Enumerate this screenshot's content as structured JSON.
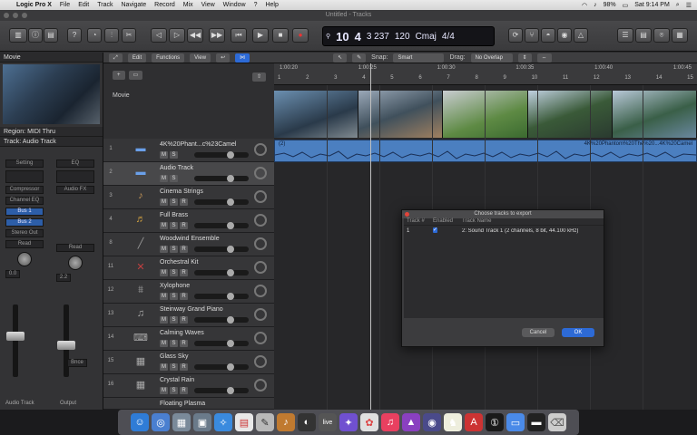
{
  "menubar": {
    "app_name": "Logic Pro X",
    "items": [
      "File",
      "Edit",
      "Track",
      "Navigate",
      "Record",
      "Mix",
      "View",
      "Window",
      "?",
      "Help"
    ],
    "battery": "98%",
    "clock": "Sat 9:14 PM"
  },
  "window": {
    "title": "Untitled - Tracks"
  },
  "lcd": {
    "bar": "10",
    "beat": "4",
    "tempo_sub": "3 237",
    "tempo": "120",
    "key": "Cmaj",
    "signature": "4/4"
  },
  "left_panel": {
    "movie_header": "Movie",
    "region_header": "Region: MIDI Thru",
    "track_header": "Track: Audio Track",
    "channel1": {
      "eq": "Setting",
      "insert1": "Compressor",
      "insert2": "Channel EQ",
      "bus1": "Bus 1",
      "bus2": "Bus 2",
      "output": "Stereo Out",
      "mode": "Read",
      "value": "0.0",
      "name": "Audio Track"
    },
    "channel2": {
      "eq": "EQ",
      "fx": "Audio FX",
      "mode": "Read",
      "value": "2.2",
      "bounce": "Bnce",
      "name": "Output"
    }
  },
  "tracks_toolbar": {
    "edit": "Edit",
    "functions": "Functions",
    "view": "View",
    "snap_label": "Snap:",
    "snap_value": "Smart",
    "drag_label": "Drag:",
    "drag_value": "No Overlap"
  },
  "movie_track_label": "Movie",
  "tracks": [
    {
      "num": "1",
      "name": "4K%20Phant...c%23Camel",
      "icon": "audio-waveform-icon"
    },
    {
      "num": "2",
      "name": "Audio Track",
      "icon": "audio-waveform-icon"
    },
    {
      "num": "3",
      "name": "Cinema Strings",
      "icon": "violin-icon"
    },
    {
      "num": "4",
      "name": "Full Brass",
      "icon": "trumpet-icon"
    },
    {
      "num": "8",
      "name": "Woodwind Ensemble",
      "icon": "flute-icon"
    },
    {
      "num": "11",
      "name": "Orchestral Kit",
      "icon": "drum-icon"
    },
    {
      "num": "12",
      "name": "Xylophone",
      "icon": "xylophone-icon"
    },
    {
      "num": "13",
      "name": "Steinway Grand Piano",
      "icon": "piano-icon"
    },
    {
      "num": "14",
      "name": "Calming Waves",
      "icon": "keyboard-icon"
    },
    {
      "num": "15",
      "name": "Glass Sky",
      "icon": "synth-icon"
    },
    {
      "num": "16",
      "name": "Crystal Rain",
      "icon": "synth-icon"
    },
    {
      "num": "",
      "name": "Floating Plasma",
      "icon": "synth-icon"
    }
  ],
  "ruler": {
    "marks": [
      "1",
      "2",
      "3",
      "4",
      "5",
      "6",
      "7",
      "8",
      "9",
      "10",
      "11",
      "12",
      "13",
      "14",
      "15"
    ],
    "times": [
      "1:00:20",
      "1:00:25",
      "1:00:30",
      "1:00:35",
      "1:00:40",
      "1:00:45"
    ]
  },
  "audio_region": {
    "name": "(2)",
    "label": "4K%20Phantom%20The%20...4K%20Camel"
  },
  "dialog": {
    "title": "Choose tracks to export",
    "col_track": "Track #",
    "col_enabled": "Enabled",
    "col_name": "Track Name",
    "rows": [
      {
        "num": "1",
        "enabled": "✓",
        "name": "2: Sound Track 1 (2 channels, 8 bit, 44.100 kHz)"
      }
    ],
    "cancel": "Cancel",
    "ok": "OK"
  }
}
